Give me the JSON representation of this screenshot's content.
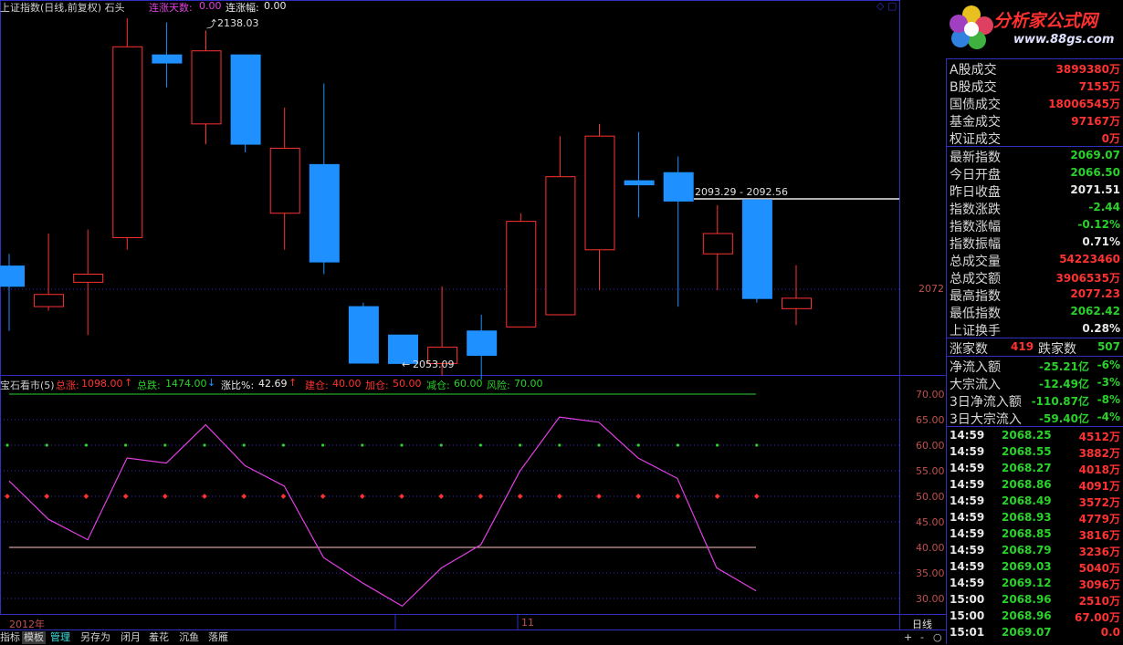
{
  "header": {
    "title": "上证指数(日线,前复权) 石头",
    "consec_days_label": "连涨天数:",
    "consec_days_value": "0.00",
    "consec_pct_label": "连涨幅:",
    "consec_pct_value": "0.00"
  },
  "price_chart": {
    "high_marker": "2138.03",
    "low_marker": "2053.09",
    "range_label": "2093.29 - 2092.56",
    "right_axis_label": "2072",
    "candles": [
      {
        "o": 2077,
        "h": 2080,
        "l": 2061,
        "c": 2072
      },
      {
        "o": 2067,
        "h": 2085,
        "l": 2066,
        "c": 2070
      },
      {
        "o": 2073,
        "h": 2086,
        "l": 2060,
        "c": 2075
      },
      {
        "o": 2084,
        "h": 2138.03,
        "l": 2081,
        "c": 2131
      },
      {
        "o": 2129,
        "h": 2137,
        "l": 2121,
        "c": 2127
      },
      {
        "o": 2112,
        "h": 2135,
        "l": 2107,
        "c": 2130
      },
      {
        "o": 2129,
        "h": 2129,
        "l": 2105,
        "c": 2107
      },
      {
        "o": 2090,
        "h": 2116,
        "l": 2081,
        "c": 2106
      },
      {
        "o": 2102,
        "h": 2122,
        "l": 2075,
        "c": 2078
      },
      {
        "o": 2067,
        "h": 2068,
        "l": 2055,
        "c": 2053.09
      },
      {
        "o": 2060,
        "h": 2060,
        "l": 2053,
        "c": 2053
      },
      {
        "o": 2053,
        "h": 2072,
        "l": 2050,
        "c": 2057
      },
      {
        "o": 2061,
        "h": 2065,
        "l": 2049,
        "c": 2055
      },
      {
        "o": 2062,
        "h": 2090,
        "l": 2062,
        "c": 2088
      },
      {
        "o": 2065,
        "h": 2109,
        "l": 2083,
        "c": 2099
      },
      {
        "o": 2081,
        "h": 2112,
        "l": 2071,
        "c": 2109
      },
      {
        "o": 2098,
        "h": 2110,
        "l": 2089,
        "c": 2097
      },
      {
        "o": 2100,
        "h": 2104,
        "l": 2067,
        "c": 2093
      },
      {
        "o": 2080,
        "h": 2092,
        "l": 2071,
        "c": 2085
      },
      {
        "o": 2093.29,
        "h": 2092.56,
        "l": 2068,
        "c": 2069
      },
      {
        "o": 2066.5,
        "h": 2077.23,
        "l": 2062.42,
        "c": 2069.07
      }
    ]
  },
  "indicator": {
    "name": "宝石看市(5)",
    "total_up_label": "总涨:",
    "total_up_value": "1098.00",
    "total_down_label": "总跌:",
    "total_down_value": "1474.00",
    "ratio_label": "涨比%:",
    "ratio_value": "42.69",
    "build_label": "建仓:",
    "build_value": "40.00",
    "add_label": "加仓:",
    "add_value": "50.00",
    "reduce_label": "减仓:",
    "reduce_value": "60.00",
    "risk_label": "风险:",
    "risk_value": "70.00",
    "axis_ticks": [
      "70.00",
      "65.00",
      "60.00",
      "55.00",
      "50.00",
      "45.00",
      "40.00",
      "35.00",
      "30.00"
    ],
    "line_values": [
      53,
      45.5,
      41.5,
      57.5,
      56.5,
      64,
      56,
      52,
      38,
      33,
      28.5,
      36,
      40.5,
      55,
      65.5,
      64.5,
      57.5,
      53.5,
      36,
      31.5
    ]
  },
  "date_axis": {
    "year_label": "2012年",
    "month_label": "11",
    "period_label": "日线"
  },
  "bottom_tabs": [
    "指标",
    "模板",
    "管理",
    "另存为",
    "闭月",
    "羞花",
    "沉鱼",
    "落雁"
  ],
  "zoom_buttons": [
    "+",
    "-",
    "○"
  ],
  "logo": {
    "text": "分析家公式网",
    "url": "www.88gs.com"
  },
  "info": {
    "rows1": [
      {
        "label": "A股成交",
        "value": "3899380万",
        "color": "up"
      },
      {
        "label": "B股成交",
        "value": "7155万",
        "color": "up"
      },
      {
        "label": "国债成交",
        "value": "18006545万",
        "color": "up"
      },
      {
        "label": "基金成交",
        "value": "97167万",
        "color": "up"
      },
      {
        "label": "权证成交",
        "value": "0万",
        "color": "up"
      }
    ],
    "rows2": [
      {
        "label": "最新指数",
        "value": "2069.07",
        "color": "dn"
      },
      {
        "label": "今日开盘",
        "value": "2066.50",
        "color": "dn"
      },
      {
        "label": "昨日收盘",
        "value": "2071.51",
        "color": "wh"
      },
      {
        "label": "指数涨跌",
        "value": "-2.44",
        "color": "dn"
      },
      {
        "label": "指数涨幅",
        "value": "-0.12%",
        "color": "dn"
      },
      {
        "label": "指数振幅",
        "value": "0.71%",
        "color": "wh"
      },
      {
        "label": "总成交量",
        "value": "54223460",
        "color": "up"
      },
      {
        "label": "总成交额",
        "value": "3906535万",
        "color": "up"
      },
      {
        "label": "最高指数",
        "value": "2077.23",
        "color": "up"
      },
      {
        "label": "最低指数",
        "value": "2062.42",
        "color": "dn"
      },
      {
        "label": "上证换手",
        "value": "0.28%",
        "color": "wh"
      }
    ],
    "adv_label": "涨家数",
    "adv_value": "419",
    "dec_label": "跌家数",
    "dec_value": "507",
    "flows": [
      {
        "label": "净流入额",
        "value": "-25.21亿",
        "pct": "-6%"
      },
      {
        "label": "大宗流入",
        "value": "-12.49亿",
        "pct": "-3%"
      },
      {
        "label": "3日净流入额",
        "value": "-110.87亿",
        "pct": "-8%"
      },
      {
        "label": "3日大宗流入",
        "value": "-59.40亿",
        "pct": "-4%"
      }
    ],
    "ticks": [
      {
        "time": "14:59",
        "price": "2068.25",
        "vol": "4512万"
      },
      {
        "time": "14:59",
        "price": "2068.55",
        "vol": "3882万"
      },
      {
        "time": "14:59",
        "price": "2068.27",
        "vol": "4018万"
      },
      {
        "time": "14:59",
        "price": "2068.86",
        "vol": "4091万"
      },
      {
        "time": "14:59",
        "price": "2068.49",
        "vol": "3572万"
      },
      {
        "time": "14:59",
        "price": "2068.93",
        "vol": "4779万"
      },
      {
        "time": "14:59",
        "price": "2068.85",
        "vol": "3816万"
      },
      {
        "time": "14:59",
        "price": "2068.79",
        "vol": "3236万"
      },
      {
        "time": "14:59",
        "price": "2069.03",
        "vol": "5040万"
      },
      {
        "time": "14:59",
        "price": "2069.12",
        "vol": "3096万"
      },
      {
        "time": "15:00",
        "price": "2068.96",
        "vol": "2510万"
      },
      {
        "time": "15:00",
        "price": "2068.96",
        "vol": "67.00万"
      },
      {
        "time": "15:01",
        "price": "2069.07",
        "vol": "0.0"
      }
    ]
  },
  "colors": {
    "up": "#ff3232",
    "down": "#1e90ff",
    "magenta": "#e040e0",
    "green": "#2ad12a",
    "frame": "#3030c0"
  }
}
